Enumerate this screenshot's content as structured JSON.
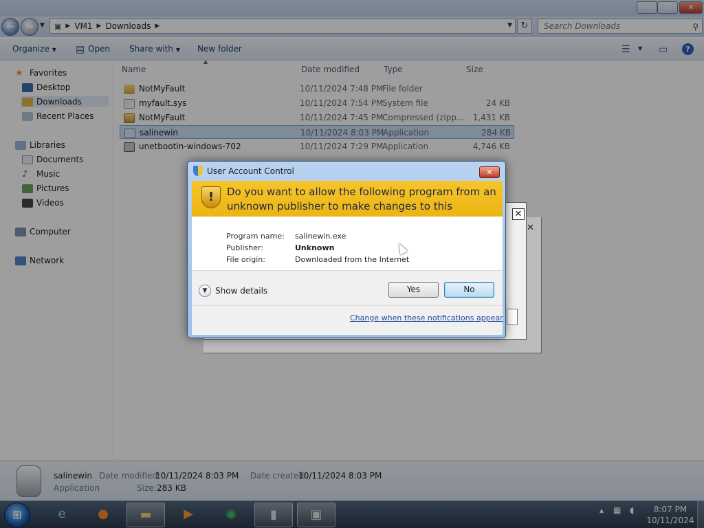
{
  "explorer": {
    "breadcrumb": [
      "VM1",
      "Downloads"
    ],
    "search_placeholder": "Search Downloads",
    "toolbar": {
      "organize": "Organize",
      "open": "Open",
      "share_with": "Share with",
      "new_folder": "New folder"
    },
    "nav": {
      "favorites": "Favorites",
      "desktop": "Desktop",
      "downloads": "Downloads",
      "recent_places": "Recent Places",
      "libraries": "Libraries",
      "documents": "Documents",
      "music": "Music",
      "pictures": "Pictures",
      "videos": "Videos",
      "computer": "Computer",
      "network": "Network"
    },
    "columns": {
      "name": "Name",
      "date_modified": "Date modified",
      "type": "Type",
      "size": "Size"
    },
    "files": [
      {
        "name": "NotMyFault",
        "date": "10/11/2024 7:48 PM",
        "type": "File folder",
        "size": "",
        "icon": "folder-icon"
      },
      {
        "name": "myfault.sys",
        "date": "10/11/2024 7:54 PM",
        "type": "System file",
        "size": "24 KB",
        "icon": "system-file-icon"
      },
      {
        "name": "NotMyFault",
        "date": "10/11/2024 7:45 PM",
        "type": "Compressed (zipp...",
        "size": "1,431 KB",
        "icon": "zip-folder-icon"
      },
      {
        "name": "salinewin",
        "date": "10/11/2024 8:03 PM",
        "type": "Application",
        "size": "284 KB",
        "icon": "application-icon"
      },
      {
        "name": "unetbootin-windows-702",
        "date": "10/11/2024 7:29 PM",
        "type": "Application",
        "size": "4,746 KB",
        "icon": "application-icon"
      }
    ],
    "details_pane": {
      "name": "salinewin",
      "kind": "Application",
      "date_modified_label": "Date modified:",
      "date_modified": "10/11/2024 8:03 PM",
      "date_created_label": "Date created:",
      "date_created": "10/11/2024 8:03 PM",
      "size_label": "Size:",
      "size": "283 KB"
    }
  },
  "uac": {
    "title": "User Account Control",
    "question": "Do you want to allow the following program from an unknown publisher to make changes to this computer?",
    "program_name_label": "Program name:",
    "program_name": "salinewin.exe",
    "publisher_label": "Publisher:",
    "publisher": "Unknown",
    "file_origin_label": "File origin:",
    "file_origin": "Downloaded from the Internet",
    "show_details": "Show details",
    "yes": "Yes",
    "no": "No",
    "change_link": "Change when these notifications appear"
  },
  "taskbar": {
    "time": "8:07 PM",
    "date": "10/11/2024"
  },
  "colors": {
    "uac_banner": "#f0bb1c",
    "selection": "#cde1f5",
    "link": "#1a4aa8"
  }
}
